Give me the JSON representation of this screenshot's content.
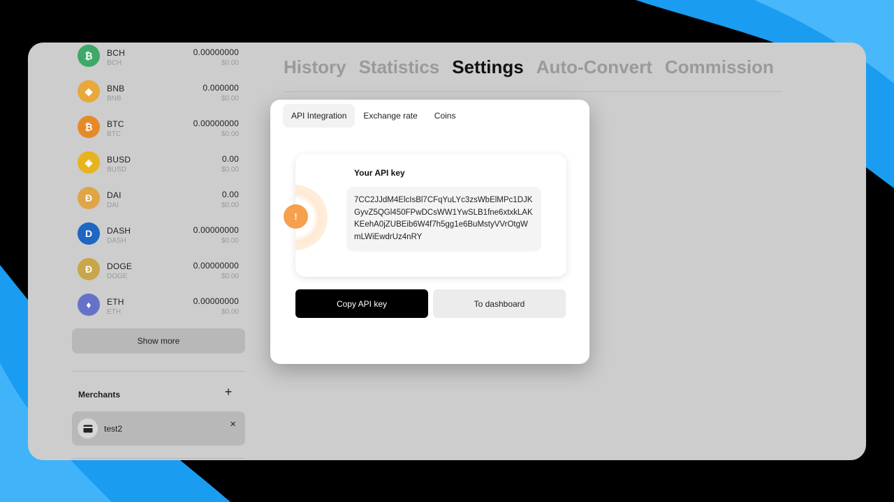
{
  "main_tabs": [
    {
      "label": "History"
    },
    {
      "label": "Statistics"
    },
    {
      "label": "Settings"
    },
    {
      "label": "Auto-Convert"
    },
    {
      "label": "Commission"
    }
  ],
  "coins": [
    {
      "name": "BCH",
      "ticker": "BCH",
      "amount": "0.00000000",
      "usd": "$0.00",
      "color": "#3fa867",
      "icon": "bitcoin-cash-icon"
    },
    {
      "name": "BNB",
      "ticker": "BNB",
      "amount": "0.000000",
      "usd": "$0.00",
      "color": "#e8a93a",
      "icon": "binance-coin-icon"
    },
    {
      "name": "BTC",
      "ticker": "BTC",
      "amount": "0.00000000",
      "usd": "$0.00",
      "color": "#e58a2b",
      "icon": "bitcoin-icon"
    },
    {
      "name": "BUSD",
      "ticker": "BUSD",
      "amount": "0.00",
      "usd": "$0.00",
      "color": "#e8b320",
      "icon": "busd-icon"
    },
    {
      "name": "DAI",
      "ticker": "DAI",
      "amount": "0.00",
      "usd": "$0.00",
      "color": "#e0a546",
      "icon": "dai-icon"
    },
    {
      "name": "DASH",
      "ticker": "DASH",
      "amount": "0.00000000",
      "usd": "$0.00",
      "color": "#1e67c2",
      "icon": "dash-icon"
    },
    {
      "name": "DOGE",
      "ticker": "DOGE",
      "amount": "0.00000000",
      "usd": "$0.00",
      "color": "#c9a64a",
      "icon": "doge-icon"
    },
    {
      "name": "ETH",
      "ticker": "ETH",
      "amount": "0.00000000",
      "usd": "$0.00",
      "color": "#6473c9",
      "icon": "ethereum-icon"
    }
  ],
  "sidebar": {
    "show_more": "Show more",
    "merchants_title": "Merchants",
    "merchant_name": "test2"
  },
  "modal": {
    "subtabs": [
      {
        "label": "API Integration"
      },
      {
        "label": "Exchange rate"
      },
      {
        "label": "Coins"
      }
    ],
    "key_title": "Your API key",
    "api_key": "7CC2JJdM4ElcIsBl7CFqYuLYc3zsWbElMPc1DJKGyvZ5QGl450FPwDCsWW1YwSLB1fne6xtxkLAKKEehA0jZUBEib6W4f7h5gg1e6BuMstyVVrOtgWmLWiEwdrUz4nRY",
    "warn_glyph": "!",
    "copy_button": "Copy API key",
    "dashboard_button": "To dashboard"
  },
  "colors": {
    "accent_orange": "#f6a04d",
    "primary_button": "#000000",
    "background_blue": "#1a9cf0"
  }
}
